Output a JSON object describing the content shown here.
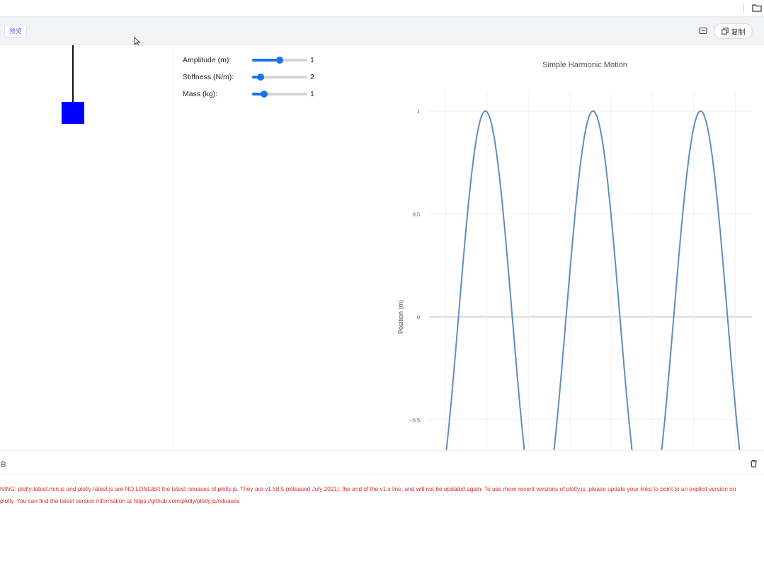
{
  "toolbar": {
    "preview_tab_label": "预览",
    "copy_label": "复制"
  },
  "controls": [
    {
      "label": "Amplitude (m):",
      "value": "1",
      "fraction": 0.5
    },
    {
      "label": "Stiffness (N/m):",
      "value": "2",
      "fraction": 0.16
    },
    {
      "label": "Mass (kg):",
      "value": "1",
      "fraction": 0.22
    }
  ],
  "chart_data": {
    "type": "line",
    "title": "Simple Harmonic Motion",
    "xlabel": "",
    "ylabel": "Position (m)",
    "ytick_labels": [
      "1",
      "0.5",
      "0",
      "−0.5"
    ],
    "ylim": [
      -0.65,
      1.1
    ],
    "xlim": [
      0.9,
      2.85
    ],
    "grid": true,
    "series": [
      {
        "color": "#5b8fc0",
        "amplitude": 1,
        "omega": 1.4142,
        "x": [
          1.0,
          1.1,
          1.2,
          1.3,
          1.4,
          1.5,
          1.6,
          1.7,
          1.8,
          1.9,
          2.0,
          2.1,
          2.2,
          2.3,
          2.4,
          2.5,
          2.6,
          2.7,
          2.8
        ],
        "note_visible": false
      }
    ]
  },
  "console": {
    "glyph": "台",
    "warning_line1": "NING: plotly-latest.min.js and plotly-latest.js are NO LONGER the latest releases of plotly.js. They are v1.58.5 (released July 2021), the end of the v1.x line, and will not be updated again. To use more recent versions of plotly.js, please update your links to point to an explicit version on",
    "warning_line2": "plotly. You can find the latest version information at https://github.com/plotly/plotly.js/releases"
  },
  "colors": {
    "mass": "#0000ff",
    "slider": "#1a73e8",
    "line": "#5b8fc0",
    "warning": "#d93025"
  }
}
